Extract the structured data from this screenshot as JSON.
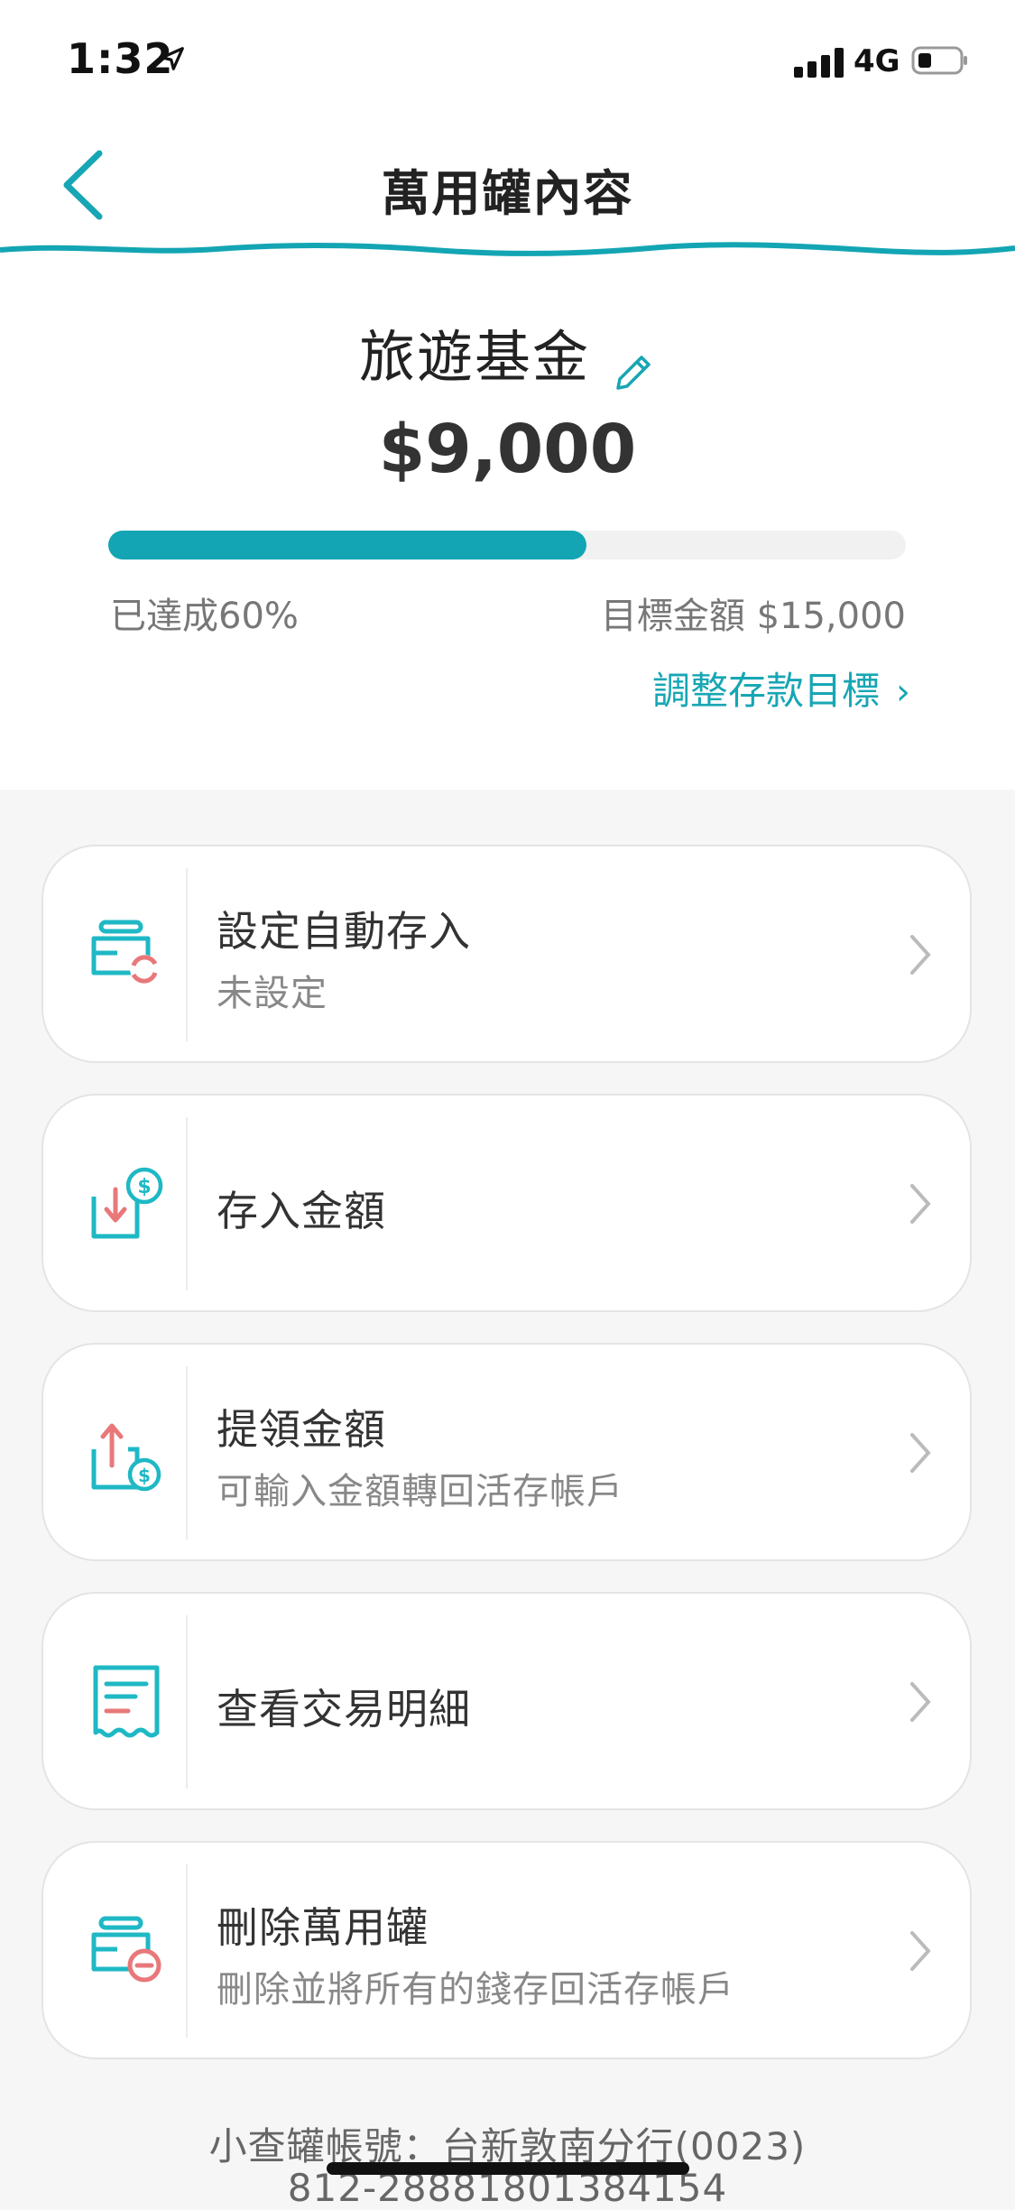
{
  "status_bar": {
    "time": "1:32",
    "network": "4G"
  },
  "header": {
    "title": "萬用罐內容"
  },
  "jar": {
    "name": "旅遊基金",
    "amount": "$9,000",
    "progress_percent": 60,
    "achieved_text": "已達成60%",
    "goal_text": "目標金額 $15,000",
    "adjust_link": "調整存款目標"
  },
  "actions": [
    {
      "title": "設定自動存入",
      "subtitle": "未設定",
      "icon": "auto-deposit-jar-icon"
    },
    {
      "title": "存入金額",
      "subtitle": "",
      "icon": "deposit-money-icon"
    },
    {
      "title": "提領金額",
      "subtitle": "可輸入金額轉回活存帳戶",
      "icon": "withdraw-money-icon"
    },
    {
      "title": "查看交易明細",
      "subtitle": "",
      "icon": "receipt-icon"
    },
    {
      "title": "刪除萬用罐",
      "subtitle": "刪除並將所有的錢存回活存帳戶",
      "icon": "delete-jar-icon"
    }
  ],
  "footer": {
    "account_label": "小查罐帳號：台新敦南分行(0023)",
    "account_number": "812-28881801384154"
  },
  "colors": {
    "accent": "#13a5b3",
    "icon_red": "#e8787a"
  }
}
